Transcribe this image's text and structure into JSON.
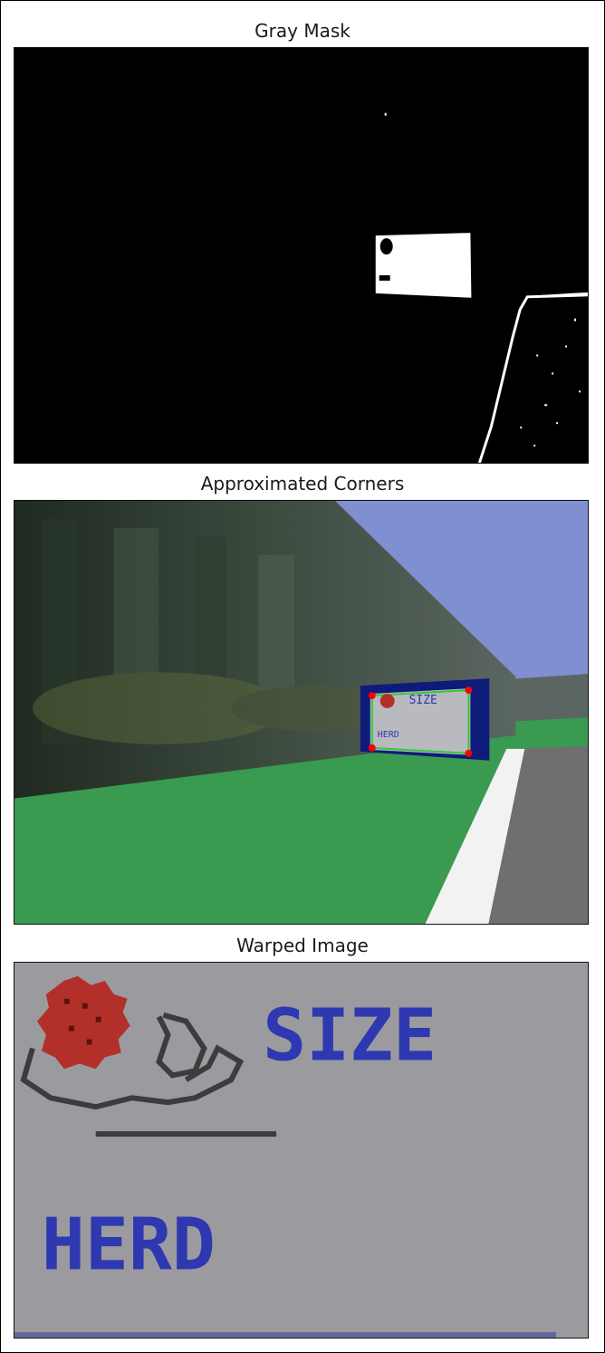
{
  "panels": {
    "gray_mask": {
      "title": "Gray Mask"
    },
    "approx_corners": {
      "title": "Approximated Corners"
    },
    "warped": {
      "title": "Warped Image"
    }
  },
  "sign": {
    "top_word": "SIZE",
    "bottom_word": "HERD"
  },
  "colors": {
    "mask_background": "#000000",
    "mask_foreground": "#ffffff",
    "grass": "#3a9a4f",
    "road": "#6f6f6f",
    "sky": "#7f8fd0",
    "sign_border": "#0f1b7a",
    "contour": "#34c93a",
    "corner_marker": "#ff0000",
    "word_blue": "#2e38b0",
    "flower_red": "#b3302a"
  },
  "icons": {
    "flower": "red-flower-drawing",
    "animal": "sketched-animal-drawing"
  }
}
